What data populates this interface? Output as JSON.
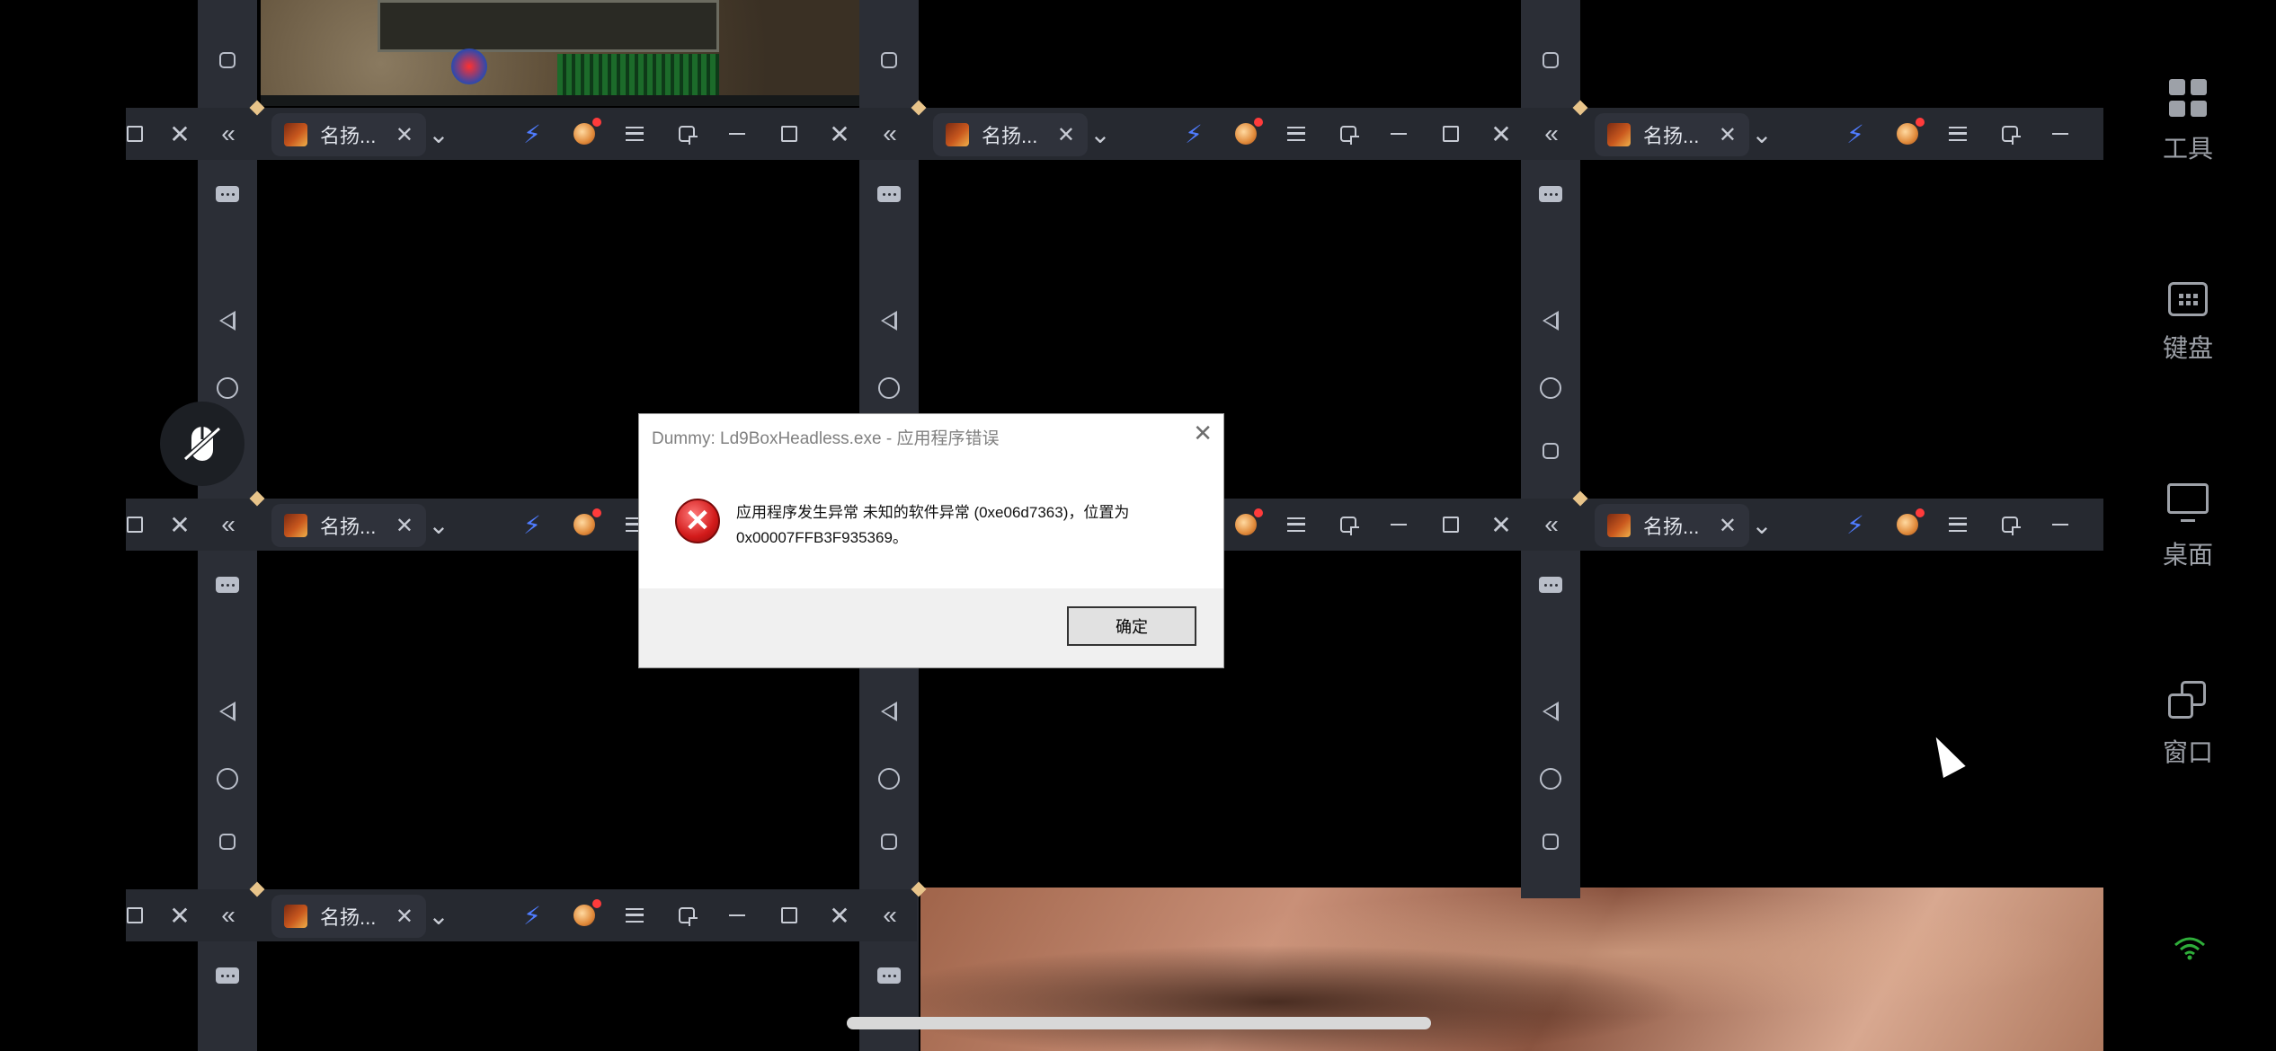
{
  "tab_label": "名扬...",
  "dialog": {
    "title": "Dummy: Ld9BoxHeadless.exe - 应用程序错误",
    "message_line1": "应用程序发生异常 未知的软件异常 (0xe06d7363)，位置为",
    "message_line2": "0x00007FFB3F935369。",
    "ok_label": "确定"
  },
  "tools": {
    "items": [
      {
        "label": "工具",
        "icon": "grid-icon"
      },
      {
        "label": "键盘",
        "icon": "keyboard-icon"
      },
      {
        "label": "桌面",
        "icon": "desktop-icon"
      },
      {
        "label": "窗口",
        "icon": "windows-icon"
      }
    ]
  },
  "colors": {
    "accent_bolt": "#4f7cff",
    "wifi": "#2fae3a",
    "error": "#d21a1a"
  }
}
